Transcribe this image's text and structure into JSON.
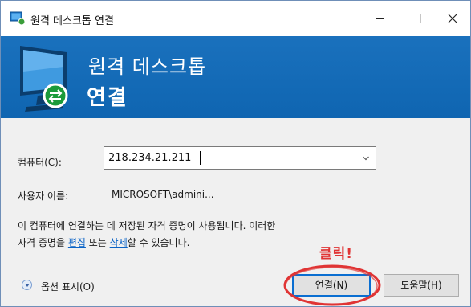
{
  "window": {
    "title": "원격 데스크톱 연결",
    "controls": {
      "minimize": "minimize",
      "maximize": "maximize",
      "close": "close"
    }
  },
  "header": {
    "line1": "원격 데스크톱",
    "line2": "연결"
  },
  "form": {
    "computer_label": "컴퓨터(C):",
    "computer_value": "218.234.21.211",
    "user_label": "사용자 이름:",
    "user_value": "MICROSOFT\\admini..."
  },
  "info": {
    "line1": "이 컴퓨터에 연결하는 데 저장된 자격 증명이 사용됩니다. 이러한",
    "line2_prefix": "자격 증명을 ",
    "edit_link": "편집",
    "line2_middle": " 또는 ",
    "delete_link": "삭제",
    "line2_suffix": "할 수 있습니다."
  },
  "buttons": {
    "options": "옵션 표시(O)",
    "connect": "연결(N)",
    "help": "도움말(H)"
  },
  "annotation": {
    "text": "클릭!"
  },
  "colors": {
    "header_blue": "#1a71bd",
    "annotation_red": "#e03434",
    "link_blue": "#0b63c6"
  }
}
